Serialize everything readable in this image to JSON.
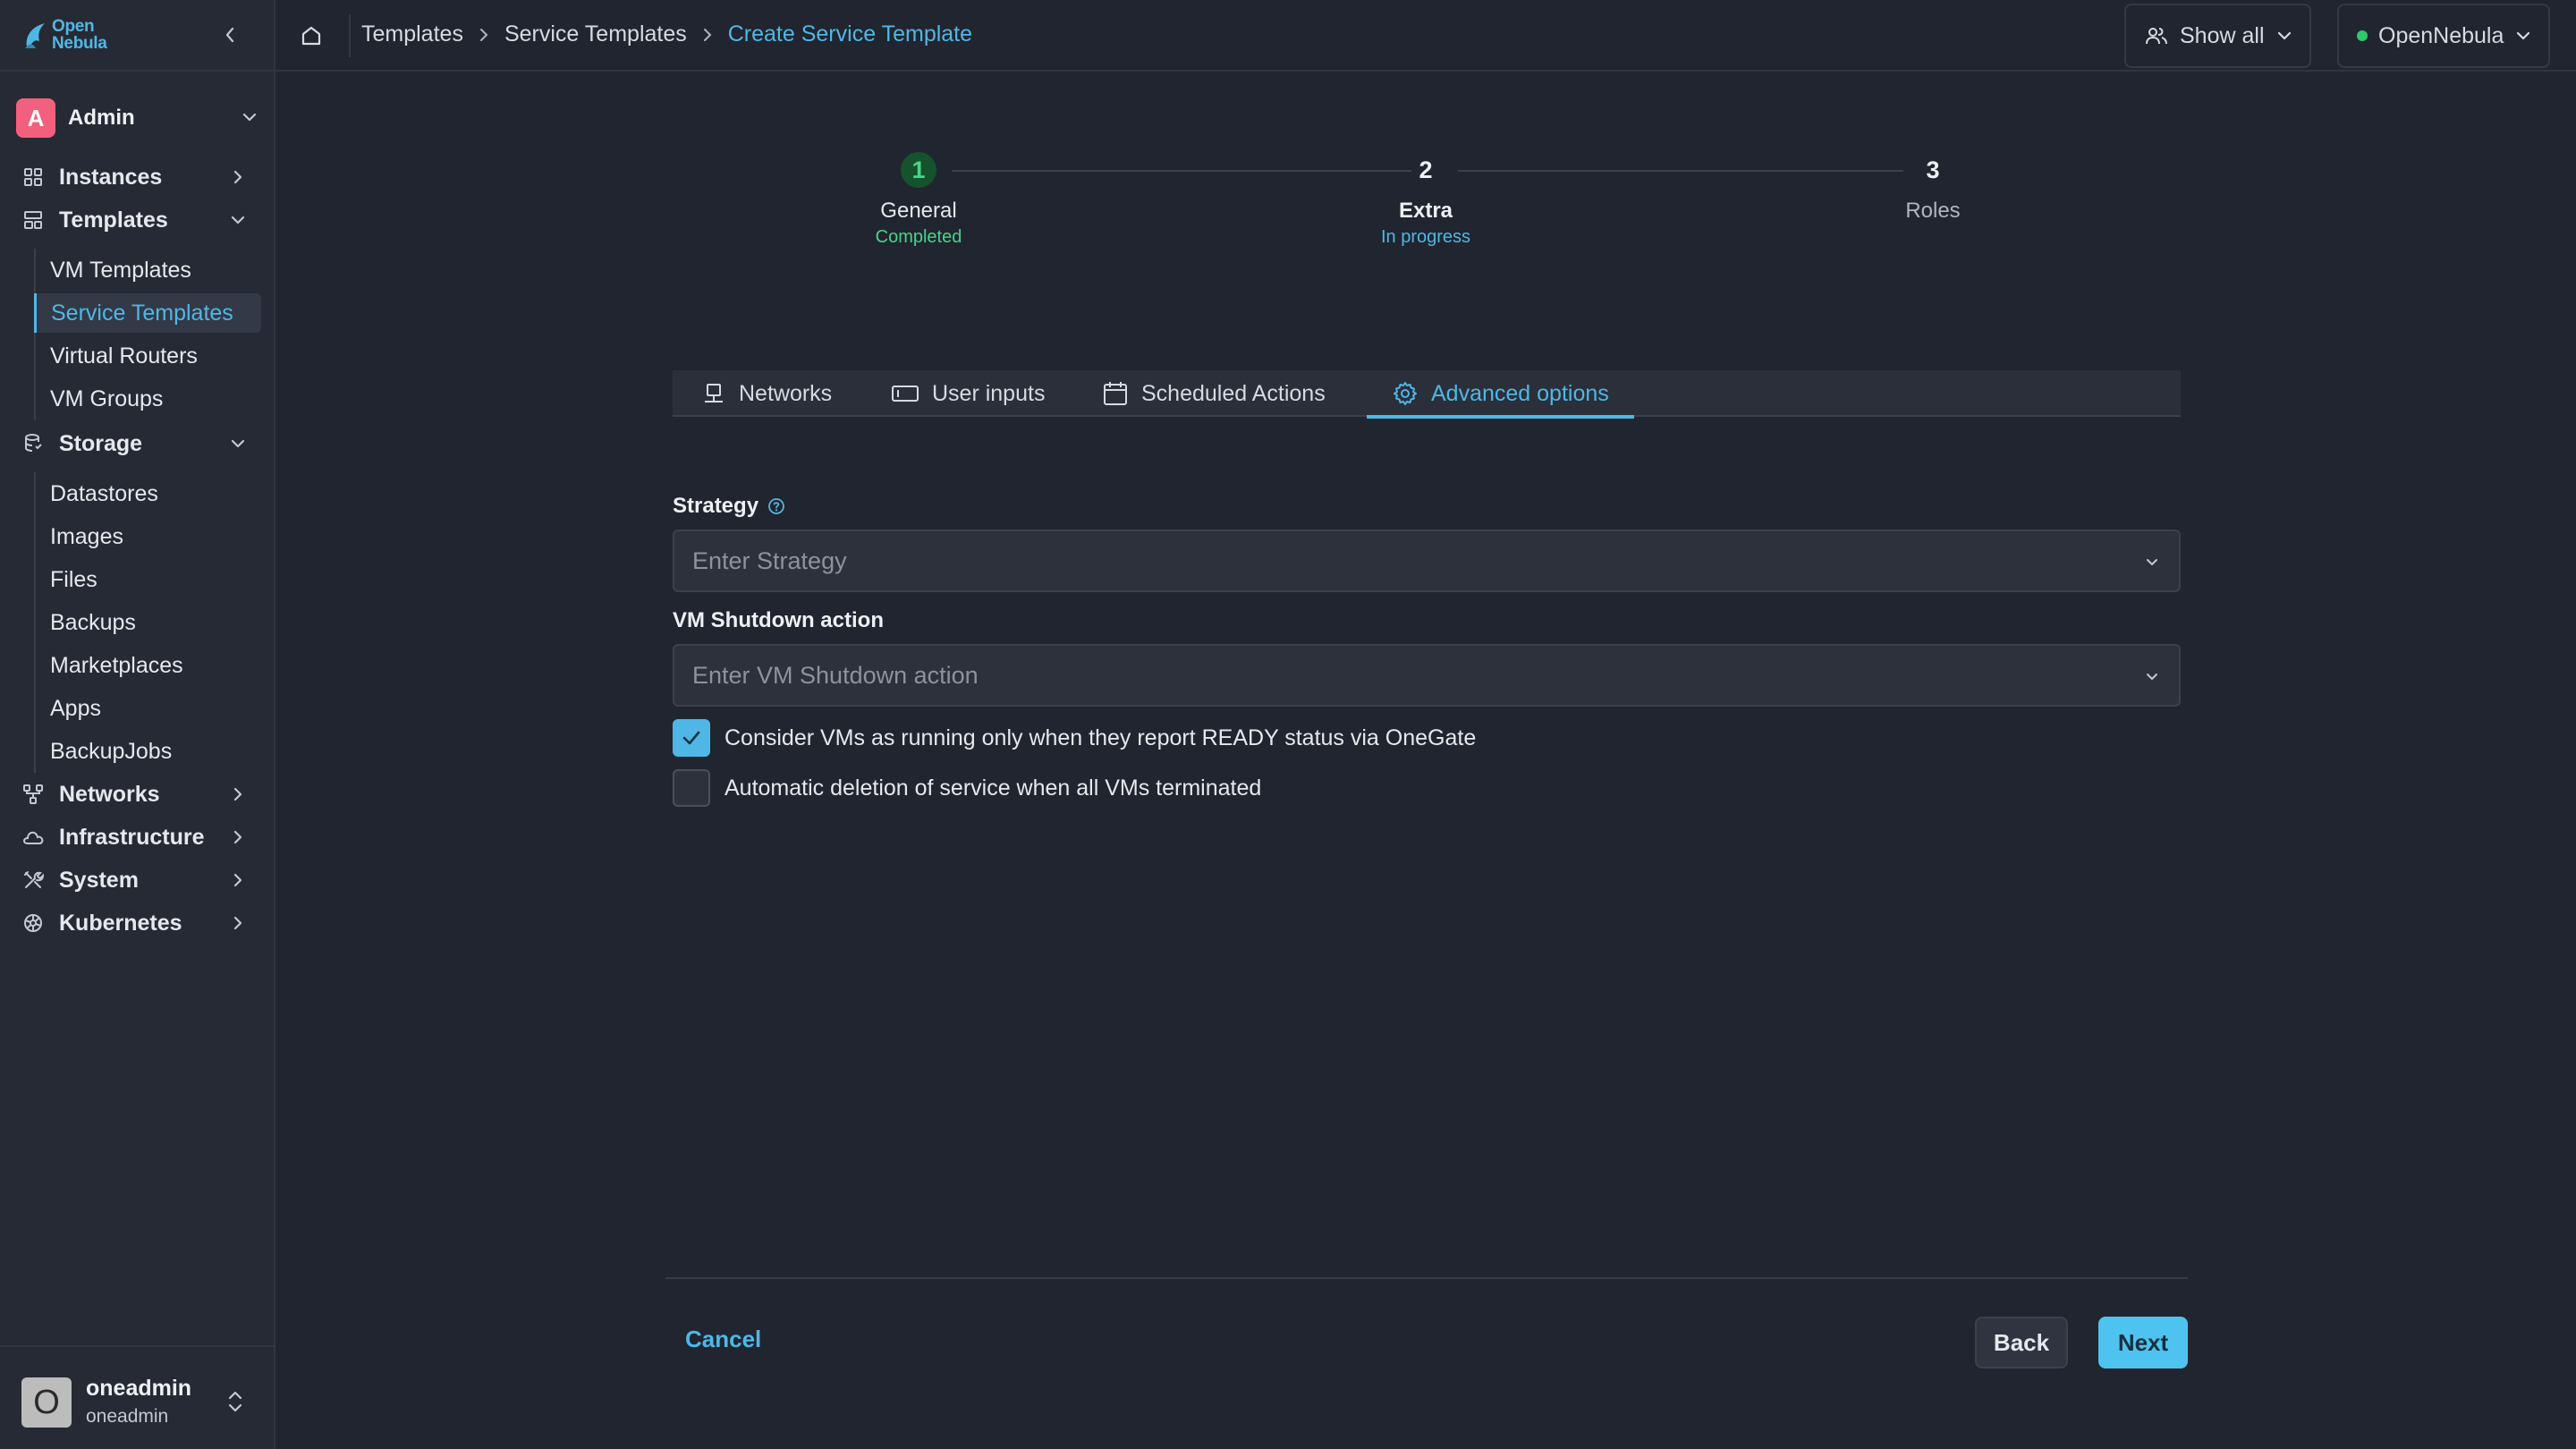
{
  "brand": {
    "line1": "Open",
    "line2": "Nebula"
  },
  "account": {
    "initial": "A",
    "name": "Admin"
  },
  "sidebar": {
    "items": [
      {
        "label": "Instances",
        "icon": "instances-icon"
      },
      {
        "label": "Templates",
        "icon": "templates-icon",
        "expanded": true,
        "children": [
          "VM Templates",
          "Service Templates",
          "Virtual Routers",
          "VM Groups"
        ]
      },
      {
        "label": "Storage",
        "icon": "storage-icon",
        "expanded": true,
        "children": [
          "Datastores",
          "Images",
          "Files",
          "Backups",
          "Marketplaces",
          "Apps",
          "BackupJobs"
        ]
      },
      {
        "label": "Networks",
        "icon": "networks-icon"
      },
      {
        "label": "Infrastructure",
        "icon": "cloud-icon"
      },
      {
        "label": "System",
        "icon": "tools-icon"
      },
      {
        "label": "Kubernetes",
        "icon": "kubernetes-icon"
      }
    ],
    "active_child": "Service Templates"
  },
  "user": {
    "initial": "O",
    "name": "oneadmin",
    "group": "oneadmin"
  },
  "breadcrumb": [
    "Templates",
    "Service Templates",
    "Create Service Template"
  ],
  "topbar": {
    "filter_label": "Show all",
    "zone_label": "OpenNebula",
    "zone_status_color": "#2ec86a"
  },
  "stepper": [
    {
      "number": "1",
      "name": "General",
      "status": "Completed"
    },
    {
      "number": "2",
      "name": "Extra",
      "status": "In progress"
    },
    {
      "number": "3",
      "name": "Roles",
      "status": ""
    }
  ],
  "tabs": [
    {
      "label": "Networks",
      "icon": "network-icon"
    },
    {
      "label": "User inputs",
      "icon": "input-icon"
    },
    {
      "label": "Scheduled Actions",
      "icon": "calendar-icon"
    },
    {
      "label": "Advanced options",
      "icon": "gear-icon",
      "active": true
    }
  ],
  "form": {
    "strategy": {
      "label": "Strategy",
      "placeholder": "Enter Strategy"
    },
    "shutdown": {
      "label": "VM Shutdown action",
      "placeholder": "Enter VM Shutdown action"
    },
    "ready_status": {
      "label": "Consider VMs as running only when they report READY status via OneGate",
      "checked": true
    },
    "auto_delete": {
      "label": "Automatic deletion of service when all VMs terminated",
      "checked": false
    }
  },
  "footer": {
    "cancel": "Cancel",
    "back": "Back",
    "next": "Next"
  },
  "colors": {
    "accent": "#4fb7e6",
    "success": "#48d48a",
    "background": "#21252f",
    "sidebar": "#262a35"
  }
}
